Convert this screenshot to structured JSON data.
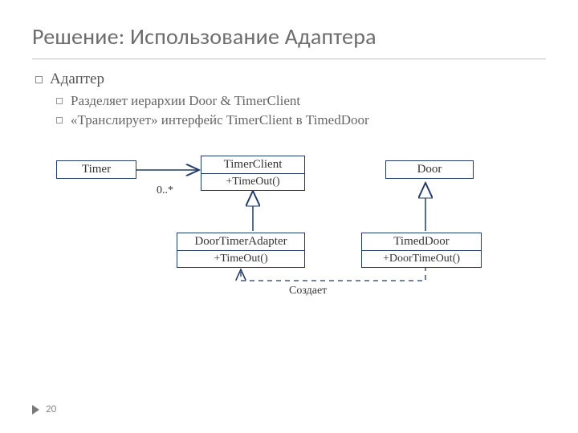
{
  "title": "Решение: Использование Адаптера",
  "bullets": {
    "main": "Адаптер",
    "sub": [
      "Разделяет иерархии Door & TimerClient",
      "«Транслирует» интерфейс TimerClient в TimedDoor"
    ]
  },
  "uml": {
    "timer": {
      "name": "Timer"
    },
    "timerclient": {
      "name": "TimerClient",
      "method": "+TimeOut()"
    },
    "door": {
      "name": "Door"
    },
    "adapter": {
      "name": "DoorTimerAdapter",
      "method": "+TimeOut()"
    },
    "timeddoor": {
      "name": "TimedDoor",
      "method": "+DoorTimeOut()"
    },
    "multiplicity": "0..*",
    "creates_label": "Создает"
  },
  "page_number": "20"
}
